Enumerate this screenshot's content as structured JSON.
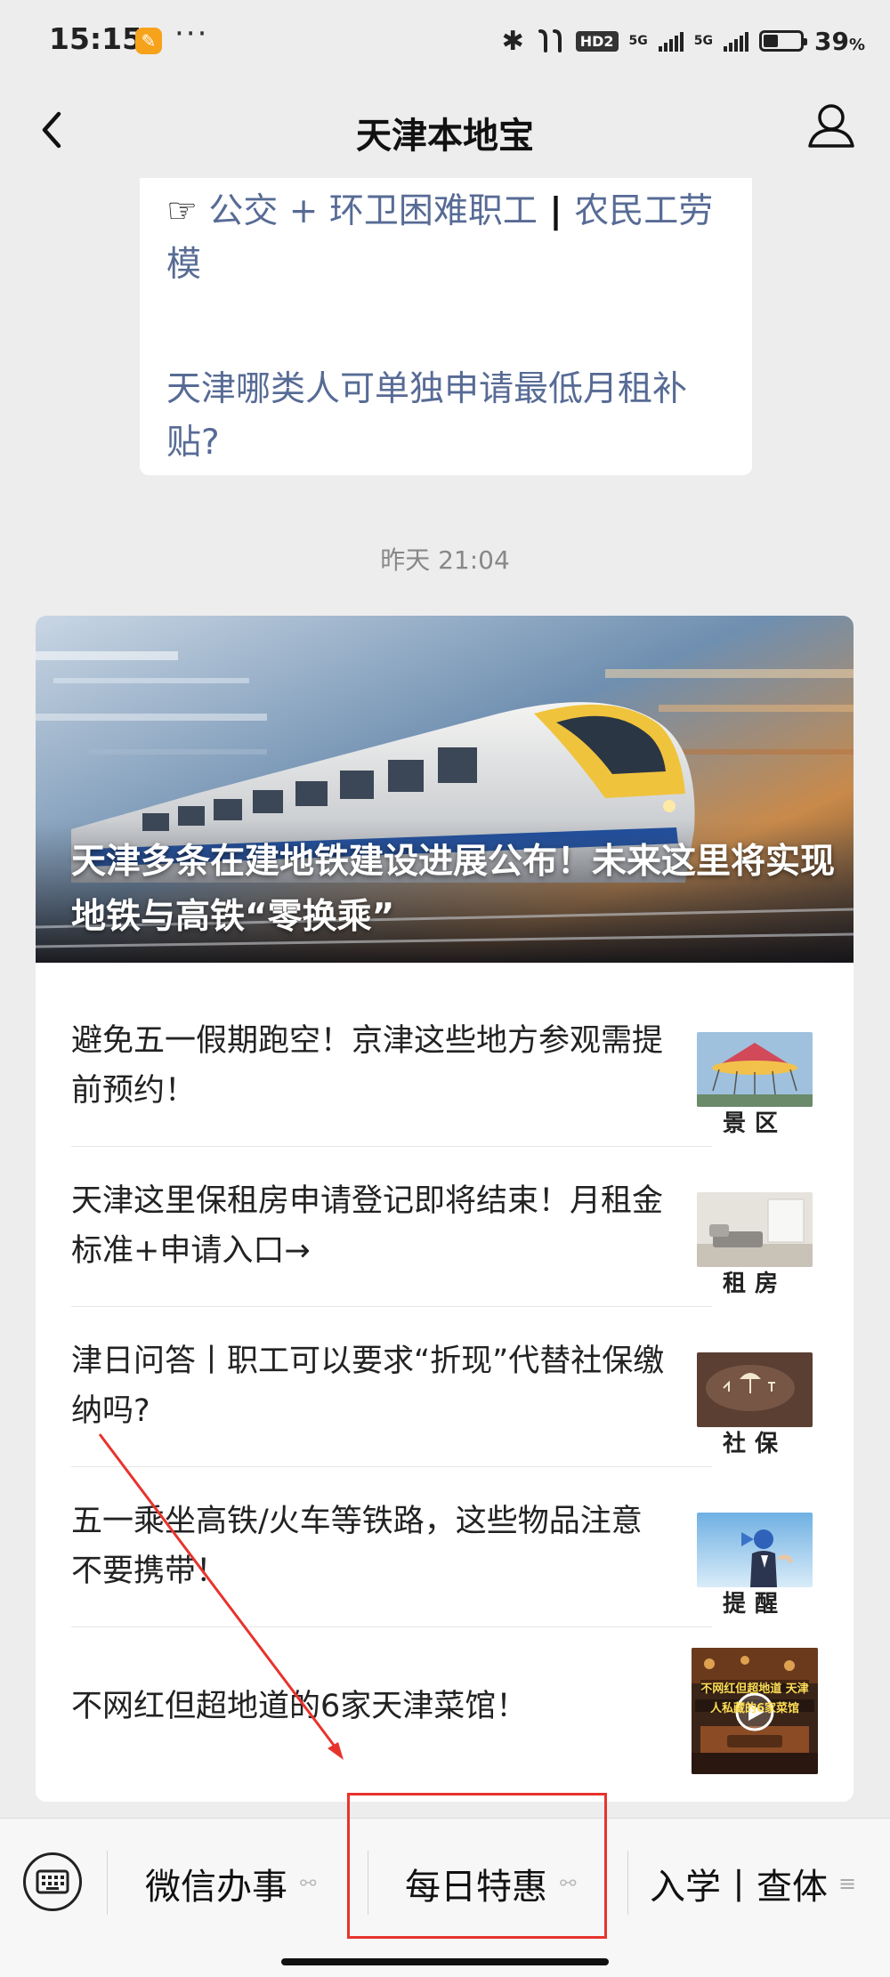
{
  "status_bar": {
    "time": "15:15",
    "app_icon_glyph": "✎",
    "dots": "···",
    "hd_label": "HD2",
    "sim1_label": "5G",
    "sim2_label": "5G",
    "battery_percent": "39",
    "battery_unit": "%",
    "battery_level": 0.39
  },
  "navbar": {
    "title": "天津本地宝",
    "back_icon": "chevron-left-icon",
    "profile_icon": "user-icon"
  },
  "prev_message": {
    "pointer_glyph": "☞",
    "link1_part1": "公交 + 环卫困难职工",
    "separator": " | ",
    "link1_part2": "农民工劳模",
    "link2": "天津哪类人可单独申请最低月租补贴?"
  },
  "timestamp": "昨天 21:04",
  "feed": {
    "cover_title": "天津多条在建地铁建设进展公布！未来这里将实现地铁与高铁“零换乘”",
    "items": [
      {
        "title": "避免五一假期跑空！京津这些地方参观需提前预约！",
        "caption": "景区"
      },
      {
        "title": "天津这里保租房申请登记即将结束！月租金标准+申请入口→",
        "caption": "租房"
      },
      {
        "title": "津日问答丨职工可以要求“折现”代替社保缴纳吗?",
        "caption": "社保"
      },
      {
        "title": "五一乘坐高铁/火车等铁路，这些物品注意不要携带！",
        "caption": "提醒"
      },
      {
        "title": "不网红但超地道的6家天津菜馆！",
        "caption": ""
      }
    ],
    "thumb5_overlay": "不网红但超地道 天津人私藏的6家菜馆"
  },
  "menu": {
    "keyboard_icon": "keyboard-icon",
    "item1": "微信办事",
    "item2": "每日特惠",
    "item3": "入学丨查体",
    "link_icon": "link-icon",
    "more_icon": "menu-lines-icon"
  },
  "colors": {
    "link": "#576b95",
    "annotation": "#e8332d",
    "background": "#ededed"
  }
}
